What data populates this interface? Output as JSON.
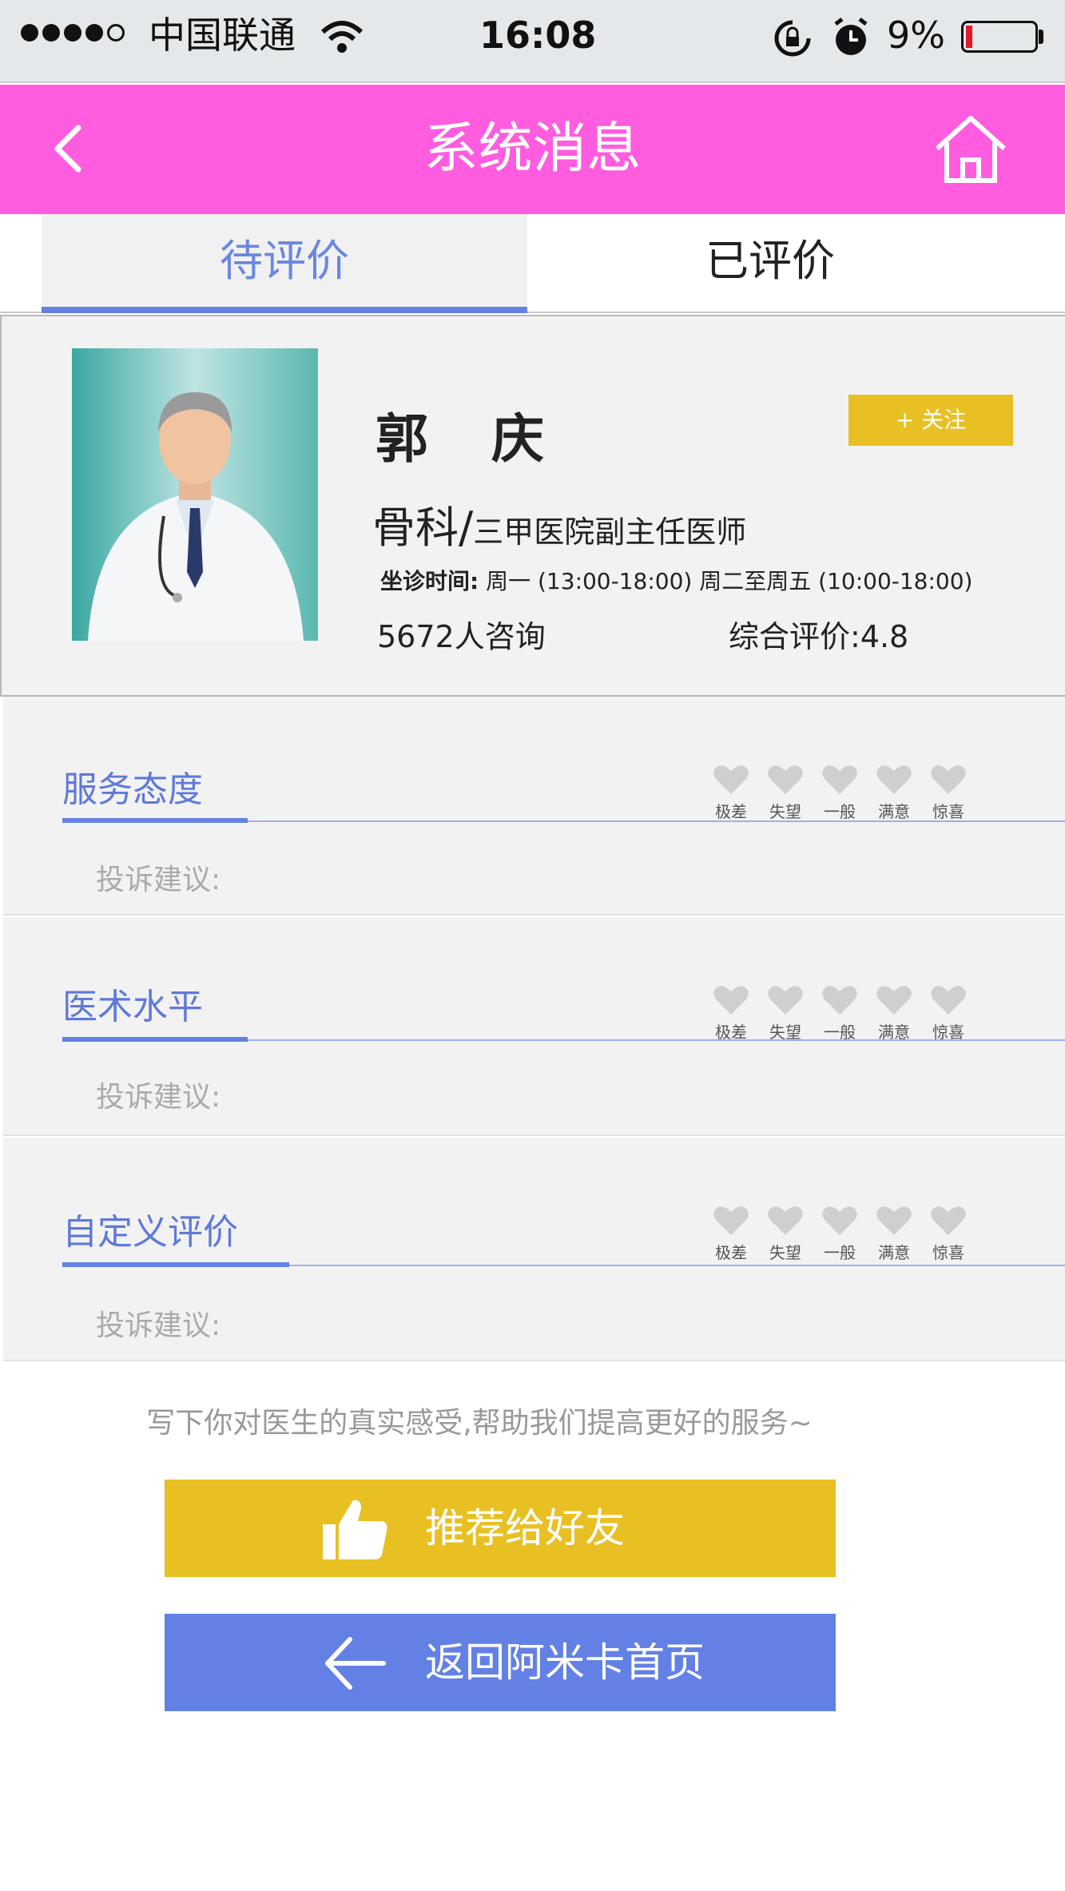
{
  "status_bar": {
    "carrier": "中国联通",
    "time": "16:08",
    "battery_text": "9%",
    "battery_level": 0.09,
    "signal_bars": 4
  },
  "header": {
    "title": "系统消息",
    "background_color": "#ff5ce0"
  },
  "tabs": [
    {
      "label": "待评价",
      "active": true
    },
    {
      "label": "已评价",
      "active": false
    }
  ],
  "doctor": {
    "name": "郭 庆",
    "follow_label": "+ 关注",
    "dept_main": "骨科",
    "dept_slash": "/",
    "dept_title": "三甲医院副主任医师",
    "schedule_label": "坐诊时间:",
    "schedule_value": "周一 (13:00-18:00) 周二至周五 (10:00-18:00)",
    "consult_count": "5672人咨询",
    "rating": "综合评价:4.8"
  },
  "heart_labels": [
    "极差",
    "失望",
    "一般",
    "满意",
    "惊喜"
  ],
  "reviews": [
    {
      "title": "服务态度",
      "complaint_placeholder": "投诉建议:"
    },
    {
      "title": "医术水平",
      "complaint_placeholder": "投诉建议:"
    },
    {
      "title": "自定义评价",
      "complaint_placeholder": "投诉建议:"
    }
  ],
  "hint_text": "写下你对医生的真实感受,帮助我们提高更好的服务~",
  "buttons": {
    "recommend": "推荐给好友",
    "return_home": "返回阿米卡首页"
  },
  "colors": {
    "accent_blue": "#6381e4",
    "accent_yellow": "#e8c024",
    "header_pink": "#ff5ce0"
  }
}
